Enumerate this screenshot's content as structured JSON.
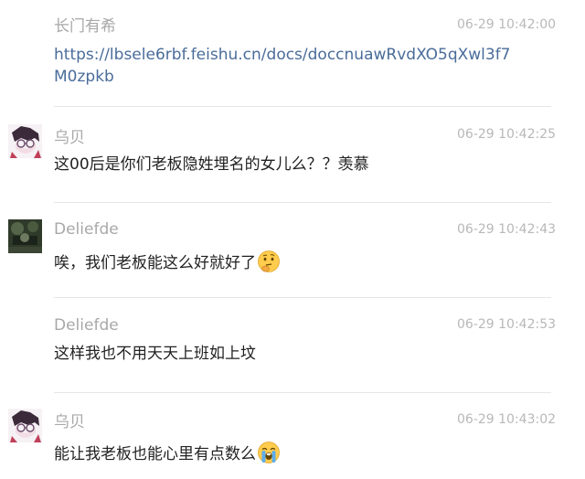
{
  "messages": [
    {
      "sender": "长门有希",
      "time": "06-29 10:42:00",
      "link_line1": "https://lbsele6rbf.feishu.cn/docs/doccnuawRvdXO5qXwl3f7",
      "link_line2": "M0zpkb",
      "avatar": "none"
    },
    {
      "sender": "乌贝",
      "time": "06-29 10:42:25",
      "text": "这00后是你们老板隐姓埋名的女儿么？？羡慕",
      "avatar": "anime-glasses-avatar"
    },
    {
      "sender": "Deliefde",
      "time": "06-29 10:42:43",
      "text": "唉，我们老板能这么好就好了",
      "emoji": "thinking-face-emoji",
      "avatar": "dark-photo-avatar"
    },
    {
      "sender": "Deliefde",
      "time": "06-29 10:42:53",
      "text": "这样我也不用天天上班如上坟",
      "avatar": "none"
    },
    {
      "sender": "乌贝",
      "time": "06-29 10:43:02",
      "text": "能让我老板也能心里有点数么",
      "emoji": "crying-face-emoji",
      "avatar": "anime-glasses-avatar"
    }
  ],
  "colors": {
    "sender": "#a8a8a8",
    "time": "#b8b8b8",
    "text": "#222222",
    "link": "#4a6c9a",
    "divider": "#e6e6e6"
  }
}
